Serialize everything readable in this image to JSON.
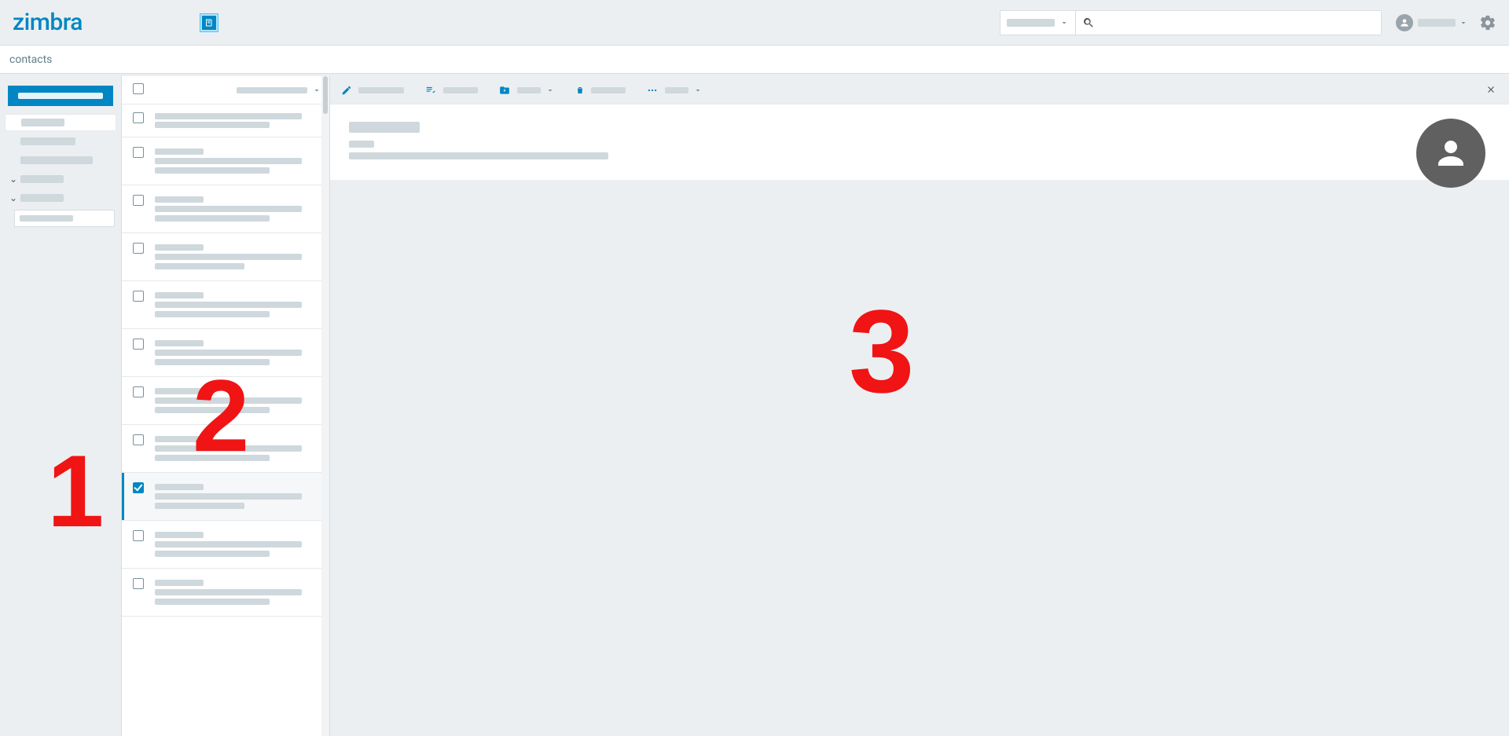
{
  "brand": {
    "name": "zimbra"
  },
  "header": {
    "search_placeholder": "",
    "scope_label": "",
    "account_label": ""
  },
  "breadcrumb": {
    "label": "contacts"
  },
  "sidebar": {
    "primary_action": "",
    "tags_label": "",
    "categories_label": ""
  },
  "list": {
    "sort_label": "",
    "rows": [
      {
        "id": 0,
        "checked": false,
        "selected": false,
        "variant": "short"
      },
      {
        "id": 1,
        "checked": false,
        "selected": false,
        "variant": "two"
      },
      {
        "id": 2,
        "checked": false,
        "selected": false,
        "variant": "two"
      },
      {
        "id": 3,
        "checked": false,
        "selected": false,
        "variant": "three"
      },
      {
        "id": 4,
        "checked": false,
        "selected": false,
        "variant": "two"
      },
      {
        "id": 5,
        "checked": false,
        "selected": false,
        "variant": "two"
      },
      {
        "id": 6,
        "checked": false,
        "selected": false,
        "variant": "two"
      },
      {
        "id": 7,
        "checked": false,
        "selected": false,
        "variant": "two"
      },
      {
        "id": 8,
        "checked": true,
        "selected": true,
        "variant": "three"
      },
      {
        "id": 9,
        "checked": false,
        "selected": false,
        "variant": "two"
      },
      {
        "id": 10,
        "checked": false,
        "selected": false,
        "variant": "two"
      }
    ]
  },
  "actions": {
    "edit": "",
    "tag": "",
    "move": "",
    "delete": "",
    "more": ""
  },
  "card": {
    "title": "",
    "label": "",
    "line": ""
  },
  "annotations": {
    "n1": "1",
    "n2": "2",
    "n3": "3"
  }
}
